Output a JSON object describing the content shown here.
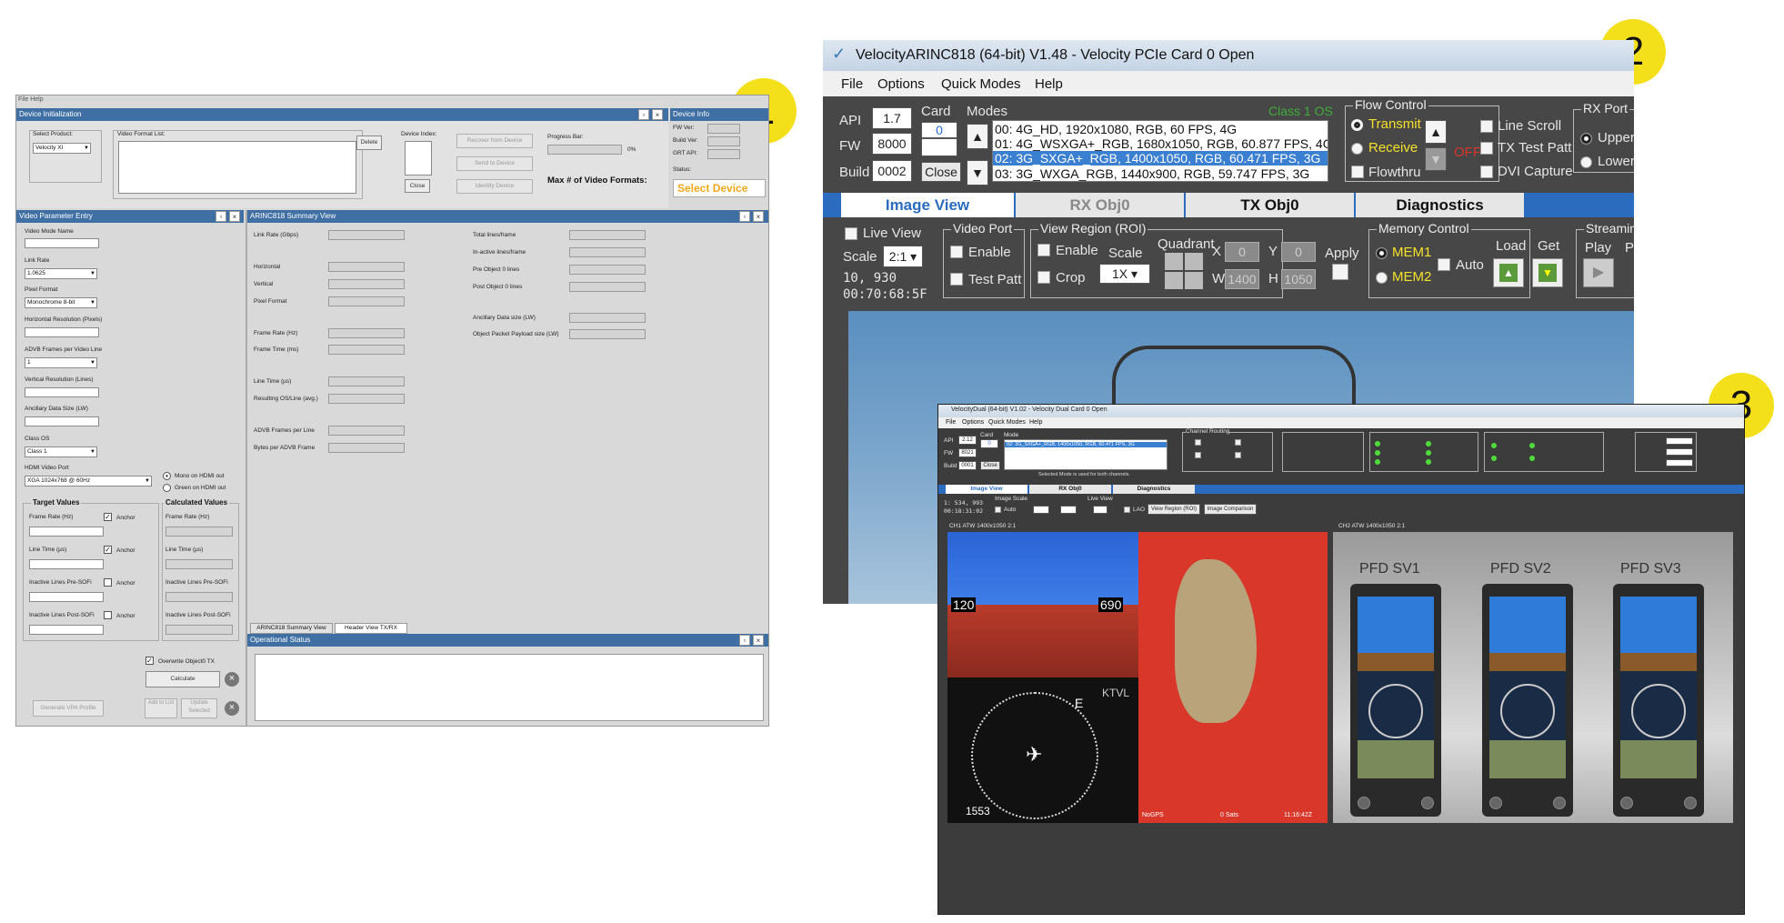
{
  "badges": [
    "1",
    "2",
    "3"
  ],
  "p1": {
    "menu": "File   Help",
    "device_init": {
      "title": "Device Initialization",
      "select_product_label": "Select Product:",
      "product_value": "Velocity XI",
      "video_format_label": "Video Format List:",
      "delete": "Delete",
      "device_index_label": "Device Index:",
      "close": "Close",
      "recover": "Recover from Device",
      "send": "Send to Device",
      "identify": "Identify Device",
      "progress_label": "Progress Bar:",
      "progress_pct": "0%",
      "max_formats": "Max # of Video Formats:"
    },
    "device_info": {
      "title": "Device Info",
      "fw_ver": "FW Ver:",
      "build_ver": "Build Ver:",
      "grt_api": "GRT API:",
      "status": "Status:",
      "select_device": "Select Device"
    },
    "vpe": {
      "title": "Video Parameter Entry",
      "video_mode_name": "Video Mode Name",
      "link_rate": "Link Rate",
      "link_rate_value": "1.0625",
      "pixel_format": "Pixel Format",
      "pixel_format_value": "Monochrome 8-bit",
      "hres": "Horizontal Resolution (Pixels)",
      "adbv_frames": "ADVB Frames per Video Line",
      "adbv_value": "1",
      "vres": "Vertical Resolution (Lines)",
      "ancillary": "Ancillary Data Size (LW)",
      "class_os": "Class OS",
      "class_value": "Class 1",
      "hdmi_port": "HDMI Video Port",
      "hdmi_value": "XGA 1024x768 @ 60Hz",
      "mono_hdmi": "Mono on HDMI out",
      "green_hdmi": "Green on HDMI out",
      "target_values": "Target Values",
      "calculated_values": "Calculated Values",
      "frame_rate": "Frame Rate (Hz)",
      "line_time": "Line Time (µs)",
      "inactive_pre": "Inactive Lines Pre-SOFi",
      "inactive_post": "Inactive Lines Post-SOFi",
      "anchor": "Anchor",
      "overwrite": "Overwrite Object0 TX",
      "calculate": "Calculate",
      "generate": "Generate VPA Profile",
      "add_list": "Add to List",
      "update_selected": "Update Selected"
    },
    "summary": {
      "title": "ARINC818 Summary View",
      "left": [
        "Link Rate (Gbps)",
        "Horizontal",
        "Vertical",
        "Pixel Format",
        "Frame Rate (Hz)",
        "Frame Time (ms)",
        "Line Time (µs)",
        "Resulting OS/Line (avg.)",
        "ADVB Frames per Line",
        "Bytes per ADVB Frame"
      ],
      "right": [
        "Total lines/frame",
        "In-active lines/frame",
        "Pre Object 0 lines",
        "Post Object 0 lines",
        "Ancillary  Data size (LW)",
        "Object Packet Payload size (LW)"
      ],
      "tab1": "ARINC818 Summary View",
      "tab2": "Header View TX/RX"
    },
    "op_status": {
      "title": "Operational Status"
    }
  },
  "p2": {
    "title": "VelocityARINC818 (64-bit) V1.48 - Velocity PCIe Card 0 Open",
    "menu": [
      "File",
      "Options",
      "Quick Modes",
      "Help"
    ],
    "api_label": "API",
    "api": "1.7",
    "fw_label": "FW",
    "fw": "8000",
    "build_label": "Build",
    "build": "0002",
    "card_label": "Card",
    "card": "0",
    "close": "Close",
    "modes_label": "Modes",
    "class_note": "Class 1 OS",
    "modes": [
      "00: 4G_HD, 1920x1080, RGB, 60 FPS, 4G",
      "01: 4G_WSXGA+_RGB, 1680x1050, RGB, 60.877 FPS, 4G",
      "02: 3G_SXGA+_RGB, 1400x1050, RGB, 60.471 FPS, 3G",
      "03: 3G_WXGA_RGB, 1440x900, RGB, 59.747 FPS, 3G"
    ],
    "flow_control": "Flow Control",
    "transmit": "Transmit",
    "receive": "Receive",
    "flowthru": "Flowthru",
    "off": "OFF",
    "line_scroll": "Line Scroll",
    "tx_test": "TX Test Patt",
    "dvi_capture": "DVI Capture",
    "rx_port": "RX Port",
    "upper": "Upper",
    "lower": "Lower",
    "tabs": [
      "Image View",
      "RX Obj0",
      "TX Obj0",
      "Diagnostics"
    ],
    "live_view": "Live View",
    "scale": "Scale",
    "scale_val": "2:1",
    "coords": "10, 930",
    "timecode": "00:70:68:5F",
    "video_port": "Video Port",
    "enable": "Enable",
    "test_patt": "Test Patt",
    "view_region": "View Region (ROI)",
    "crop": "Crop",
    "scale2": "Scale",
    "scale2_val": "1X",
    "quadrant": "Quadrant",
    "x": "X",
    "y": "Y",
    "w": "W",
    "h": "H",
    "x_val": "0",
    "y_val": "0",
    "w_val": "1400",
    "h_val": "1050",
    "apply": "Apply",
    "memory_control": "Memory Control",
    "mem1": "MEM1",
    "mem2": "MEM2",
    "auto": "Auto",
    "load": "Load",
    "get": "Get",
    "streaming": "Streamin",
    "play": "Play",
    "p": "P"
  },
  "p3": {
    "title": "VelocityDual (64-bit) V1.02 - Velocity Dual Card 0 Open",
    "menu": [
      "File",
      "Options",
      "Quick Modes",
      "Help"
    ],
    "api_label": "API",
    "api": "2.12",
    "fw_label": "FW",
    "fw": "8021",
    "build_label": "Build",
    "build": "0001",
    "card_label": "Card",
    "card": "0",
    "close": "Close",
    "mode_label": "Mode",
    "mode_sel": "02: 3G_SXGA+_RGB, 1400x1050, RGB, 60.471 FPS, 3G",
    "mode_note": "Selected Mode is used for both channels.",
    "channel_routing": "Channel Routing",
    "tabs": [
      "Image View",
      "RX Obj0",
      "Diagnostics"
    ],
    "coords": "1: 534, 993",
    "time": "00:18:31:02",
    "image_scale": "Image Scale",
    "auto": "Auto",
    "live_view": "Live View",
    "lao": "LAO",
    "view_region": "View Region (ROI)",
    "image_comparison": "Image Comparison",
    "ch1": "CH1 ATW 1400x1050 2:1",
    "ch2": "CH2 ATW 1400x1050 2:1",
    "pfd": [
      "PFD SV1",
      "PFD SV2",
      "PFD SV3"
    ],
    "sats": "0 Sats",
    "time2": "11:16:42Z",
    "nogps": "NoGPS",
    "alt_readout": "690",
    "spd_readout": "120",
    "mp": "1553",
    "ktvl": "KTVL"
  }
}
